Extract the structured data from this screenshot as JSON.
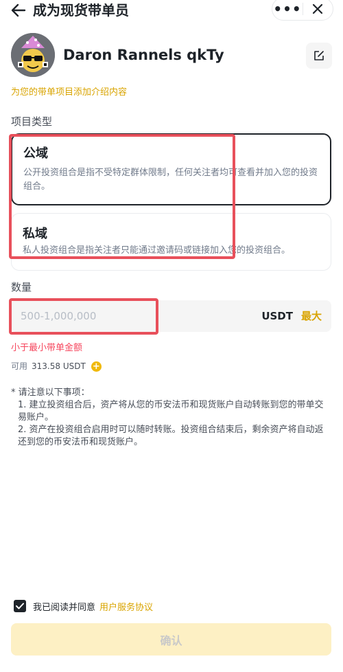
{
  "header": {
    "title": "成为现货带单员",
    "back_icon": "arrow-left-icon",
    "more_icon": "more-dots-icon",
    "more_label": "•••",
    "close_icon": "close-icon"
  },
  "profile": {
    "username": "Daron Rannels qkTy",
    "avatar_icon": "avatar",
    "edit_icon": "edit-icon"
  },
  "intro_link": "为您的带单项目添加介绍内容",
  "project_type": {
    "label": "项目类型",
    "options": [
      {
        "title": "公域",
        "description": "公开投资组合是指不受特定群体限制，任何关注者均可查看并加入您的投资组合。",
        "selected": true
      },
      {
        "title": "私域",
        "description": "私人投资组合是指关注者只能通过邀请码或链接加入您的投资组合。",
        "selected": false
      }
    ]
  },
  "amount": {
    "label": "数量",
    "value": "",
    "placeholder": "500-1,000,000",
    "unit": "USDT",
    "max_label": "最大"
  },
  "error_text": "小于最小带单金额",
  "available": {
    "label": "可用",
    "value": "313.58 USDT",
    "add_icon": "plus-circle-icon",
    "add_symbol": "+"
  },
  "notes": {
    "heading": "* 请注意以下事项：",
    "items": [
      "1. 建立投资组合后，资产将从您的币安法币和现货账户自动转账到您的带单交易账户。",
      "2. 资产在投资组合启用时可以随时转账。投资组合结束后，剩余资产将自动返还到您的币安法币和现货账户。"
    ]
  },
  "agreement": {
    "checked": true,
    "text": "我已阅读并同意",
    "link": "用户服务协议"
  },
  "confirm_label": "确认",
  "colors": {
    "accent": "#F0B90B",
    "link": "#D9A400",
    "error": "#F6465D",
    "highlight": "#E8505B",
    "confirm_disabled_bg": "#FDF0C4"
  }
}
